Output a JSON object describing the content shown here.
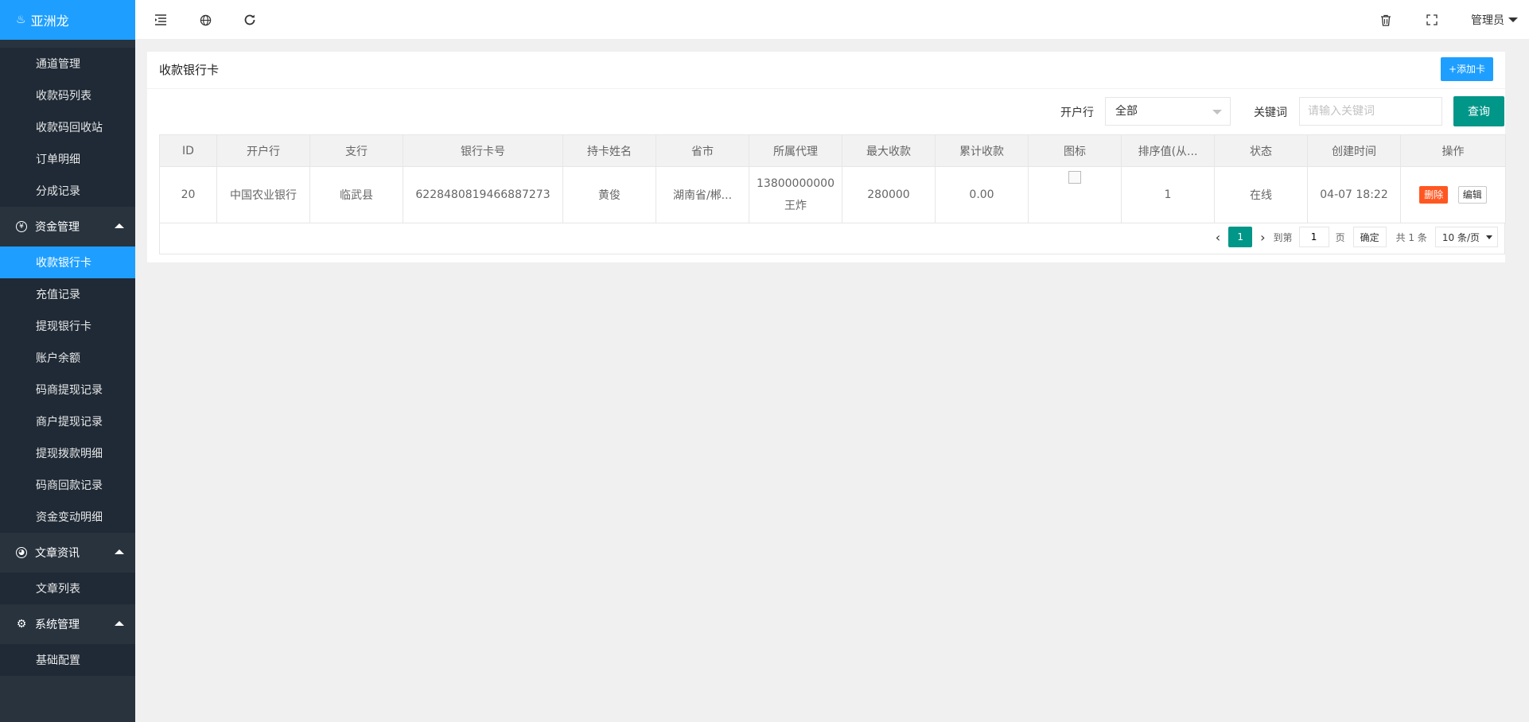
{
  "app": {
    "name": "亚洲龙"
  },
  "sidebar": {
    "items_top": [
      {
        "label": "通道管理"
      },
      {
        "label": "收款码列表"
      },
      {
        "label": "收款码回收站"
      },
      {
        "label": "订单明细"
      },
      {
        "label": "分成记录"
      }
    ],
    "groups": [
      {
        "label": "资金管理",
        "icon": "yen-circle-icon",
        "items": [
          {
            "label": "收款银行卡",
            "active": true
          },
          {
            "label": "充值记录"
          },
          {
            "label": "提现银行卡"
          },
          {
            "label": "账户余额"
          },
          {
            "label": "码商提现记录"
          },
          {
            "label": "商户提现记录"
          },
          {
            "label": "提现拨款明细"
          },
          {
            "label": "码商回款记录"
          },
          {
            "label": "资金变动明细"
          }
        ]
      },
      {
        "label": "文章资讯",
        "icon": "palette-icon",
        "items": [
          {
            "label": "文章列表"
          }
        ]
      },
      {
        "label": "系统管理",
        "icon": "gear-icon",
        "items": [
          {
            "label": "基础配置"
          }
        ]
      }
    ]
  },
  "header": {
    "admin_label": "管理员"
  },
  "card": {
    "title": "收款银行卡",
    "add_button": "+添加卡"
  },
  "filters": {
    "bank_label": "开户行",
    "bank_value": "全部",
    "keyword_label": "关键词",
    "keyword_placeholder": "请输入关键词",
    "query_button": "查询"
  },
  "table": {
    "headers": [
      "ID",
      "开户行",
      "支行",
      "银行卡号",
      "持卡姓名",
      "省市",
      "所属代理",
      "最大收款",
      "累计收款",
      "图标",
      "排序值(从...",
      "状态",
      "创建时间",
      "操作"
    ],
    "rows": [
      {
        "id": "20",
        "bank": "中国农业银行",
        "branch": "临武县",
        "card_no": "6228480819466887273",
        "holder": "黄俊",
        "region": "湖南省/郴...",
        "agent_phone": "13800000000",
        "agent_name": "王炸",
        "max_amount": "280000",
        "total_amount": "0.00",
        "sort": "1",
        "status": "在线",
        "created": "04-07 18:22",
        "delete_label": "删除",
        "edit_label": "编辑"
      }
    ]
  },
  "pager": {
    "current_page": "1",
    "goto_label": "到第",
    "goto_value": "1",
    "page_unit": "页",
    "confirm": "确定",
    "total": "共 1 条",
    "page_size": "10 条/页"
  },
  "colors": {
    "brand_blue": "#1e9fff",
    "sidebar_bg": "#28333e",
    "teal": "#009688",
    "danger": "#ff5722"
  }
}
